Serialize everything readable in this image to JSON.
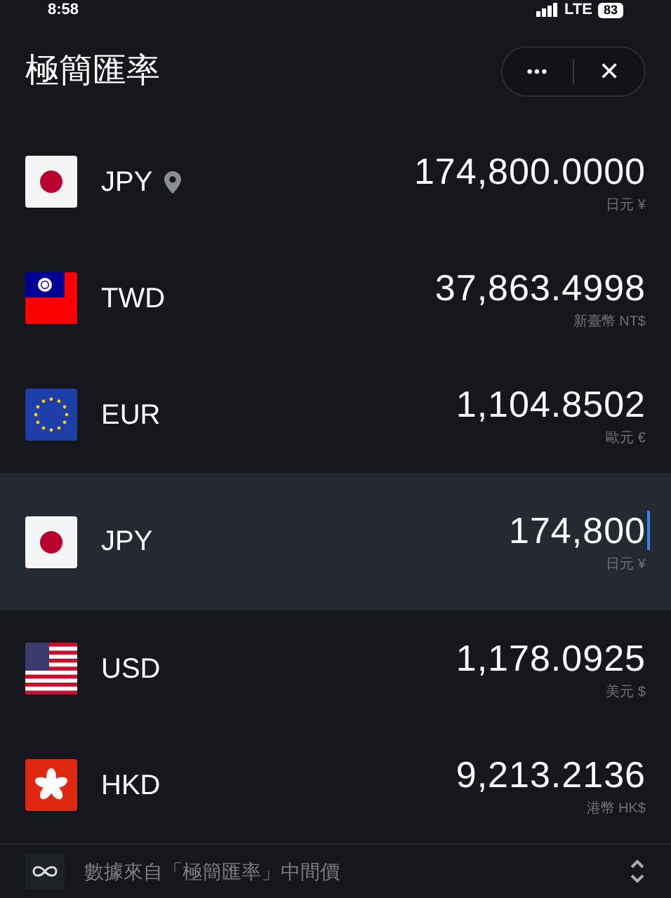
{
  "status_bar": {
    "time": "8:58",
    "network": "LTE",
    "battery": "83"
  },
  "header": {
    "title": "極簡匯率",
    "more_button": "•••",
    "close_button": "✕"
  },
  "rows": [
    {
      "kind": "jp",
      "code": "JPY",
      "located": true,
      "selected": false,
      "amount": "174,800.0000",
      "unit": "日元 ¥"
    },
    {
      "kind": "tw",
      "code": "TWD",
      "located": false,
      "selected": false,
      "amount": "37,863.4998",
      "unit": "新臺幣 NT$"
    },
    {
      "kind": "eu",
      "code": "EUR",
      "located": false,
      "selected": false,
      "amount": "1,104.8502",
      "unit": "歐元 €"
    },
    {
      "kind": "jp",
      "code": "JPY",
      "located": false,
      "selected": true,
      "amount": "174,800",
      "unit": "日元 ¥"
    },
    {
      "kind": "us",
      "code": "USD",
      "located": false,
      "selected": false,
      "amount": "1,178.0925",
      "unit": "美元 $"
    },
    {
      "kind": "hk",
      "code": "HKD",
      "located": false,
      "selected": false,
      "amount": "9,213.2136",
      "unit": "港幣 HK$"
    }
  ],
  "footer": {
    "source": "數據來自「極簡匯率」中間價"
  }
}
